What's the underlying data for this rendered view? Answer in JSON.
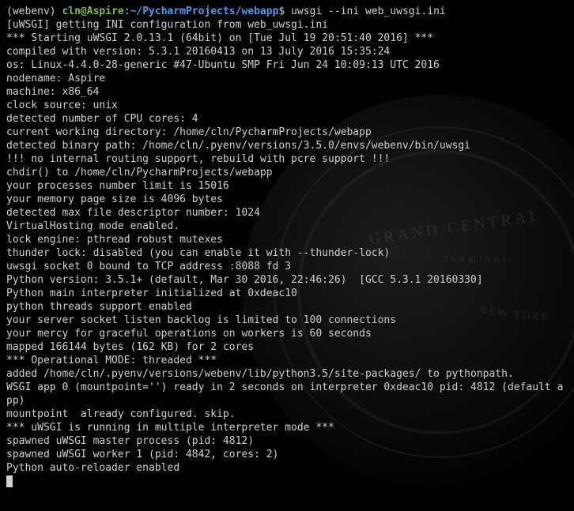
{
  "prompt": {
    "env": "(webenv)",
    "user_host": "cln@Aspire",
    "colon": ":",
    "path": "~/PycharmProjects/webapp",
    "dollar": "$",
    "command": "uwsgi --ini web_uwsgi.ini"
  },
  "output": [
    "[uWSGI] getting INI configuration from web_uwsgi.ini",
    "*** Starting uWSGI 2.0.13.1 (64bit) on [Tue Jul 19 20:51:40 2016] ***",
    "compiled with version: 5.3.1 20160413 on 13 July 2016 15:35:24",
    "os: Linux-4.4.0-28-generic #47-Ubuntu SMP Fri Jun 24 10:09:13 UTC 2016",
    "nodename: Aspire",
    "machine: x86_64",
    "clock source: unix",
    "detected number of CPU cores: 4",
    "current working directory: /home/cln/PycharmProjects/webapp",
    "detected binary path: /home/cln/.pyenv/versions/3.5.0/envs/webenv/bin/uwsgi",
    "!!! no internal routing support, rebuild with pcre support !!!",
    "chdir() to /home/cln/PycharmProjects/webapp",
    "your processes number limit is 15016",
    "your memory page size is 4096 bytes",
    "detected max file descriptor number: 1024",
    "VirtualHosting mode enabled.",
    "lock engine: pthread robust mutexes",
    "thunder lock: disabled (you can enable it with --thunder-lock)",
    "uwsgi socket 0 bound to TCP address :8088 fd 3",
    "Python version: 3.5.1+ (default, Mar 30 2016, 22:46:26)  [GCC 5.3.1 20160330]",
    "Python main interpreter initialized at 0xdeac10",
    "python threads support enabled",
    "your server socket listen backlog is limited to 100 connections",
    "your mercy for graceful operations on workers is 60 seconds",
    "mapped 166144 bytes (162 KB) for 2 cores",
    "*** Operational MODE: threaded ***",
    "added /home/cln/.pyenv/versions/webenv/lib/python3.5/site-packages/ to pythonpath.",
    "WSGI app 0 (mountpoint='') ready in 2 seconds on interpreter 0xdeac10 pid: 4812 (default app)",
    "mountpoint  already configured. skip.",
    "*** uWSGI is running in multiple interpreter mode ***",
    "spawned uWSGI master process (pid: 4812)",
    "spawned uWSGI worker 1 (pid: 4842, cores: 2)",
    "Python auto-reloader enabled"
  ],
  "background": {
    "text1": "GRAND CENTRAL",
    "text2": "TERMINAL",
    "text3": "NEW YORK"
  }
}
